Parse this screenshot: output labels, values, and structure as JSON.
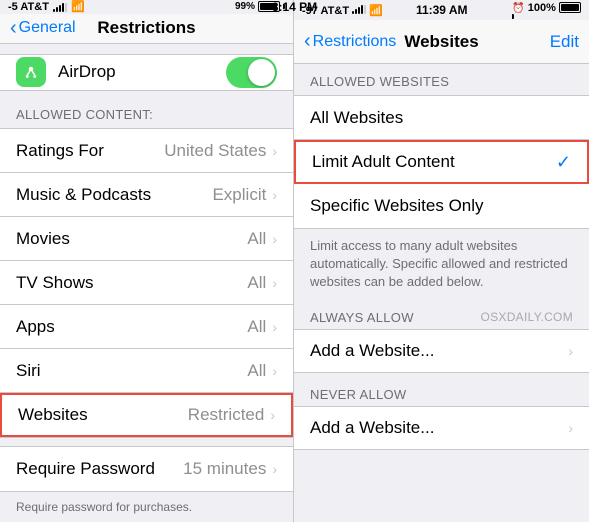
{
  "left_panel": {
    "status_bar": {
      "carrier": "-5 AT&T",
      "signal": "●●●●○",
      "wifi": "wifi",
      "time": "3:14 PM",
      "battery_percent": "99%",
      "battery_icon": "battery"
    },
    "nav": {
      "back_label": "General",
      "title": "Restrictions"
    },
    "airdrop": {
      "label": "AirDrop",
      "toggle_on": true
    },
    "allowed_content_header": "ALLOWED CONTENT:",
    "items": [
      {
        "label": "Ratings For",
        "value": "United States",
        "highlighted": false
      },
      {
        "label": "Music & Podcasts",
        "value": "Explicit",
        "highlighted": false
      },
      {
        "label": "Movies",
        "value": "All",
        "highlighted": false
      },
      {
        "label": "TV Shows",
        "value": "All",
        "highlighted": false
      },
      {
        "label": "Apps",
        "value": "All",
        "highlighted": false
      },
      {
        "label": "Siri",
        "value": "All",
        "highlighted": false
      },
      {
        "label": "Websites",
        "value": "Restricted",
        "highlighted": true
      }
    ],
    "require_password_label": "Require Password",
    "require_password_value": "15 minutes",
    "require_password_note": "Require password for purchases."
  },
  "right_panel": {
    "status_bar": {
      "carrier": "-97 AT&T",
      "wifi": "wifi",
      "time": "11:39 AM",
      "alarm": "alarm",
      "battery_percent": "100%"
    },
    "nav": {
      "back_label": "Restrictions",
      "title": "Websites",
      "edit_label": "Edit"
    },
    "allowed_websites_header": "ALLOWED WEBSITES",
    "website_options": [
      {
        "label": "All Websites",
        "selected": false
      },
      {
        "label": "Limit Adult Content",
        "selected": true
      },
      {
        "label": "Specific Websites Only",
        "selected": false
      }
    ],
    "description": "Limit access to many adult websites automatically. Specific allowed and restricted websites can be added below.",
    "always_allow_header": "ALWAYS ALLOW",
    "watermark": "osxdaily.com",
    "add_always_label": "Add a Website...",
    "never_allow_header": "NEVER ALLOW",
    "add_never_label": "Add a Website..."
  }
}
